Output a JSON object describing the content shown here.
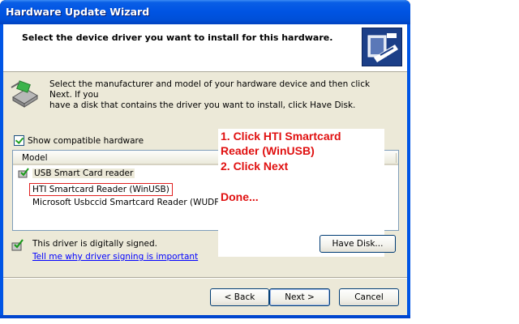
{
  "window": {
    "title": "Hardware Update Wizard"
  },
  "header": {
    "title": "Select the device driver you want to install for this hardware."
  },
  "intro": {
    "line1": "Select the manufacturer and model of your hardware device and then click Next. If you",
    "line2": "have a disk that contains the driver you want to install, click Have Disk."
  },
  "compatible": {
    "label": "Show compatible hardware",
    "checked": true
  },
  "list": {
    "column": "Model",
    "rows": [
      "USB Smart Card reader",
      "HTI Smartcard Reader (WinUSB)",
      "Microsoft Usbccid Smartcard Reader (WUDF)"
    ]
  },
  "annotation": {
    "line1": "1. Click HTI Smartcard",
    "line2": "Reader (WinUSB)",
    "line3": "2. Click Next",
    "line4": "Done...",
    "color": "#e01010"
  },
  "signing": {
    "status": "This driver is digitally signed.",
    "link": "Tell me why driver signing is important"
  },
  "buttons": {
    "have_disk": "Have Disk...",
    "back": "< Back",
    "next": "Next >",
    "cancel": "Cancel"
  }
}
